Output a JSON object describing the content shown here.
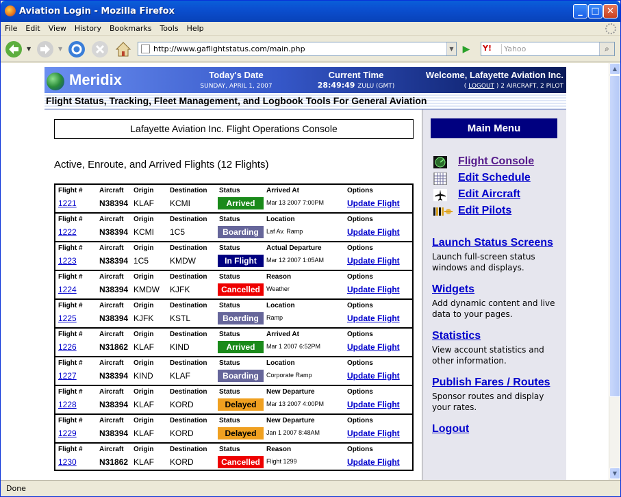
{
  "window": {
    "title": "Aviation Login - Mozilla Firefox"
  },
  "menu": [
    "File",
    "Edit",
    "View",
    "History",
    "Bookmarks",
    "Tools",
    "Help"
  ],
  "nav": {
    "url": "http://www.gaflightstatus.com/main.php",
    "search_placeholder": "Yahoo",
    "search_engine": "Y!"
  },
  "status_bar": "Done",
  "banner": {
    "logo": "Meridix",
    "date_label": "Today's Date",
    "date_value": "SUNDAY, APRIL 1, 2007",
    "time_label": "Current Time",
    "time_value": "28:49:49",
    "time_suffix": "ZULU (GMT)",
    "welcome": "Welcome, Lafayette Aviation Inc.",
    "logout_link": "LOGOUT",
    "account_summary": "2 AIRCRAFT, 2 PILOT"
  },
  "tagline": "Flight Status, Tracking, Fleet Management, and Logbook Tools For General Aviation",
  "console_title": "Lafayette Aviation Inc. Flight Operations Console",
  "flights_heading": "Active, Enroute, and Arrived Flights",
  "flights_count": "(12 Flights)",
  "headers": {
    "flight": "Flight #",
    "aircraft": "Aircraft",
    "origin": "Origin",
    "destination": "Destination",
    "status": "Status",
    "options": "Options"
  },
  "update_label": "Update Flight",
  "flights": [
    {
      "num": "1221",
      "aircraft": "N38394",
      "origin": "KLAF",
      "dest": "KCMI",
      "status": "Arrived",
      "info_label": "Arrived At",
      "info": "Mar 13 2007 7:00PM"
    },
    {
      "num": "1222",
      "aircraft": "N38394",
      "origin": "KCMI",
      "dest": "1C5",
      "status": "Boarding",
      "info_label": "Location",
      "info": "Laf Av. Ramp"
    },
    {
      "num": "1223",
      "aircraft": "N38394",
      "origin": "1C5",
      "dest": "KMDW",
      "status": "In Flight",
      "info_label": "Actual Departure",
      "info": "Mar 12 2007 1:05AM"
    },
    {
      "num": "1224",
      "aircraft": "N38394",
      "origin": "KMDW",
      "dest": "KJFK",
      "status": "Cancelled",
      "info_label": "Reason",
      "info": "Weather"
    },
    {
      "num": "1225",
      "aircraft": "N38394",
      "origin": "KJFK",
      "dest": "KSTL",
      "status": "Boarding",
      "info_label": "Location",
      "info": "Ramp"
    },
    {
      "num": "1226",
      "aircraft": "N31862",
      "origin": "KLAF",
      "dest": "KIND",
      "status": "Arrived",
      "info_label": "Arrived At",
      "info": "Mar 1 2007 6:52PM"
    },
    {
      "num": "1227",
      "aircraft": "N38394",
      "origin": "KIND",
      "dest": "KLAF",
      "status": "Boarding",
      "info_label": "Location",
      "info": "Corporate Ramp"
    },
    {
      "num": "1228",
      "aircraft": "N38394",
      "origin": "KLAF",
      "dest": "KORD",
      "status": "Delayed",
      "info_label": "New Departure",
      "info": "Mar 13 2007 4:00PM"
    },
    {
      "num": "1229",
      "aircraft": "N38394",
      "origin": "KLAF",
      "dest": "KORD",
      "status": "Delayed",
      "info_label": "New Departure",
      "info": "Jan 1 2007 8:48AM"
    },
    {
      "num": "1230",
      "aircraft": "N31862",
      "origin": "KLAF",
      "dest": "KORD",
      "status": "Cancelled",
      "info_label": "Reason",
      "info": "Flight 1299"
    }
  ],
  "status_colors": {
    "Arrived": "#1a8a1a",
    "Boarding": "#66669a",
    "In Flight": "#000080",
    "Cancelled": "#ee0000",
    "Delayed": "#f0a020"
  },
  "status_text_colors": {
    "Arrived": "#ffffff",
    "Boarding": "#ffffff",
    "In Flight": "#ffffff",
    "Cancelled": "#ffffff",
    "Delayed": "#000000"
  },
  "side": {
    "menu_title": "Main Menu",
    "items": [
      {
        "label": "Flight Console",
        "icon": "radar-icon"
      },
      {
        "label": "Edit Schedule",
        "icon": "calendar-grid-icon"
      },
      {
        "label": "Edit Aircraft",
        "icon": "airplane-icon"
      },
      {
        "label": "Edit Pilots",
        "icon": "pilot-wings-icon"
      }
    ],
    "sections": [
      {
        "title": "Launch Status Screens",
        "desc": "Launch full-screen status windows and displays."
      },
      {
        "title": "Widgets",
        "desc": "Add dynamic content and live data to your pages."
      },
      {
        "title": "Statistics",
        "desc": "View account statistics and other information."
      },
      {
        "title": "Publish Fares / Routes",
        "desc": "Sponsor routes and display your rates."
      },
      {
        "title": "Logout",
        "desc": ""
      }
    ]
  }
}
